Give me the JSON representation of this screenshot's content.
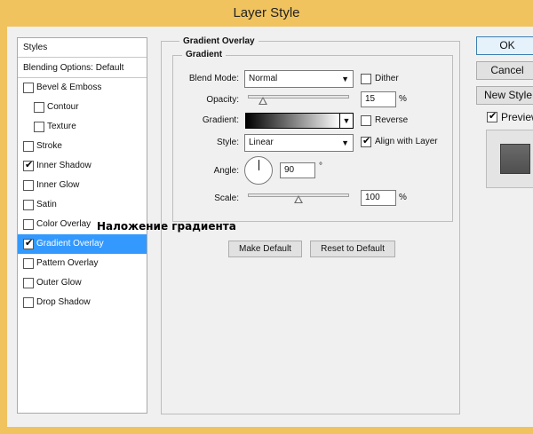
{
  "window": {
    "title": "Layer Style"
  },
  "styles_panel": {
    "header": "Styles",
    "blending_options": "Blending Options: Default",
    "items": [
      {
        "label": "Bevel & Emboss",
        "checked": false,
        "sub": false
      },
      {
        "label": "Contour",
        "checked": false,
        "sub": true
      },
      {
        "label": "Texture",
        "checked": false,
        "sub": true
      },
      {
        "label": "Stroke",
        "checked": false,
        "sub": false
      },
      {
        "label": "Inner Shadow",
        "checked": true,
        "sub": false
      },
      {
        "label": "Inner Glow",
        "checked": false,
        "sub": false
      },
      {
        "label": "Satin",
        "checked": false,
        "sub": false
      },
      {
        "label": "Color Overlay",
        "checked": false,
        "sub": false
      },
      {
        "label": "Gradient Overlay",
        "checked": true,
        "sub": false,
        "selected": true
      },
      {
        "label": "Pattern Overlay",
        "checked": false,
        "sub": false
      },
      {
        "label": "Outer Glow",
        "checked": false,
        "sub": false
      },
      {
        "label": "Drop Shadow",
        "checked": false,
        "sub": false
      }
    ]
  },
  "annotation": "Наложение градиента",
  "gradient_overlay": {
    "group_title": "Gradient Overlay",
    "subgroup_title": "Gradient",
    "blend_mode_label": "Blend Mode:",
    "blend_mode_value": "Normal",
    "dither_label": "Dither",
    "dither_checked": false,
    "opacity_label": "Opacity:",
    "opacity_value": "15",
    "opacity_fraction": 0.15,
    "percent": "%",
    "gradient_label": "Gradient:",
    "reverse_label": "Reverse",
    "reverse_checked": false,
    "style_label": "Style:",
    "style_value": "Linear",
    "align_label": "Align with Layer",
    "align_checked": true,
    "angle_label": "Angle:",
    "angle_value": "90",
    "degree_symbol": "°",
    "scale_label": "Scale:",
    "scale_value": "100",
    "scale_fraction": 0.5,
    "make_default": "Make Default",
    "reset_default": "Reset to Default"
  },
  "buttons": {
    "ok": "OK",
    "cancel": "Cancel",
    "new_style": "New Style...",
    "preview_label": "Preview",
    "preview_checked": true
  },
  "icons": {
    "dropdown": "chevron-down-icon",
    "check": "check-icon",
    "angle": "angle-dial-icon"
  },
  "colors": {
    "title_bar": "#f0c35f",
    "selection": "#3399ff"
  }
}
